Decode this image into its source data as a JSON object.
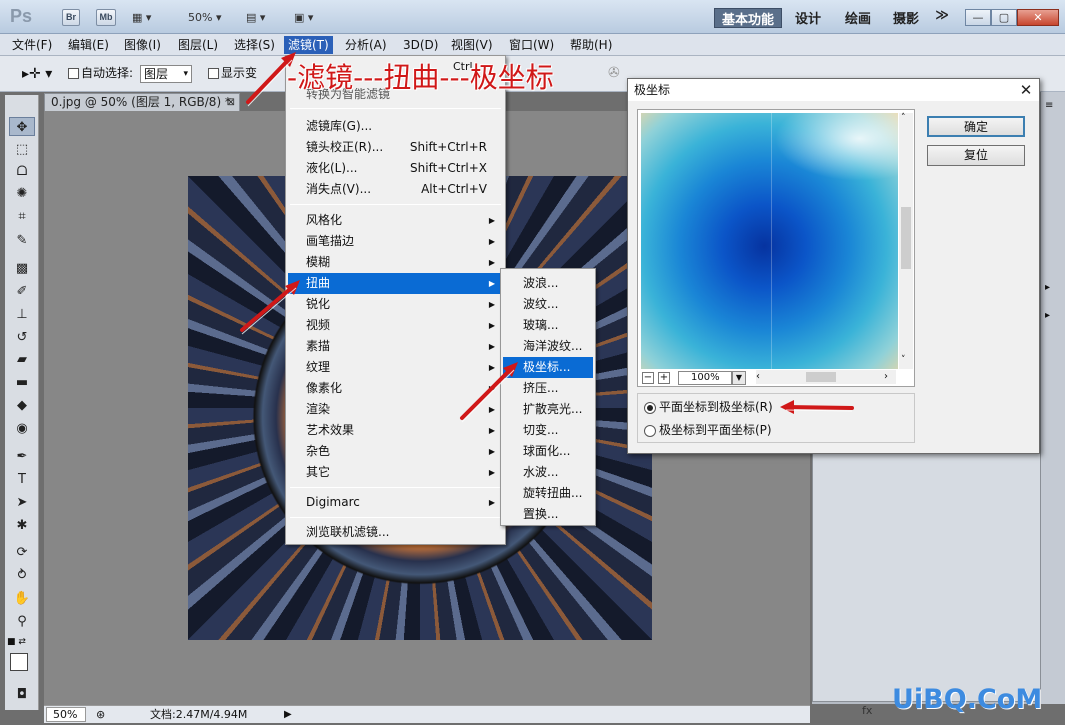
{
  "app": {
    "logo": "Ps",
    "chips": [
      "Br",
      "Mb"
    ],
    "zoom": "50%",
    "workspaces": [
      "基本功能",
      "设计",
      "绘画",
      "摄影"
    ],
    "more": "≫"
  },
  "menubar": [
    "文件(F)",
    "编辑(E)",
    "图像(I)",
    "图层(L)",
    "选择(S)",
    "滤镜(T)",
    "分析(A)",
    "3D(D)",
    "视图(V)",
    "窗口(W)",
    "帮助(H)"
  ],
  "options": {
    "auto_select_label": "自动选择:",
    "auto_select_value": "图层",
    "show_transform_label": "显示变"
  },
  "document": {
    "tab": "0.jpg @ 50% (图层 1, RGB/8) *",
    "status_zoom": "50%",
    "status_doc": "文档:2.47M/4.94M"
  },
  "filter_menu": {
    "top_partial": "转换为智能滤镜",
    "ctrl": "Ctrl",
    "group1": [
      {
        "label": "滤镜库(G)...",
        "shortcut": ""
      },
      {
        "label": "镜头校正(R)...",
        "shortcut": "Shift+Ctrl+R"
      },
      {
        "label": "液化(L)...",
        "shortcut": "Shift+Ctrl+X"
      },
      {
        "label": "消失点(V)...",
        "shortcut": "Alt+Ctrl+V"
      }
    ],
    "group2": [
      "风格化",
      "画笔描边",
      "模糊",
      "扭曲",
      "锐化",
      "视频",
      "素描",
      "纹理",
      "像素化",
      "渲染",
      "艺术效果",
      "杂色",
      "其它"
    ],
    "group3": [
      "Digimarc"
    ],
    "group4": [
      "浏览联机滤镜..."
    ]
  },
  "distort_menu": [
    "波浪...",
    "波纹...",
    "玻璃...",
    "海洋波纹...",
    "极坐标...",
    "挤压...",
    "扩散亮光...",
    "切变...",
    "球面化...",
    "水波...",
    "旋转扭曲...",
    "置换..."
  ],
  "dialog": {
    "title": "极坐标",
    "ok": "确定",
    "reset": "复位",
    "zoom": "100%",
    "option1": "平面坐标到极坐标(R)",
    "option2": "极坐标到平面坐标(P)",
    "selected_option": 1
  },
  "annotation": "-滤镜---扭曲---极坐标",
  "watermark": "UiBQ.CoM",
  "colors": {
    "highlight": "#0a6bd4",
    "annotation": "#d01818",
    "watermark": "#3d8be0"
  }
}
